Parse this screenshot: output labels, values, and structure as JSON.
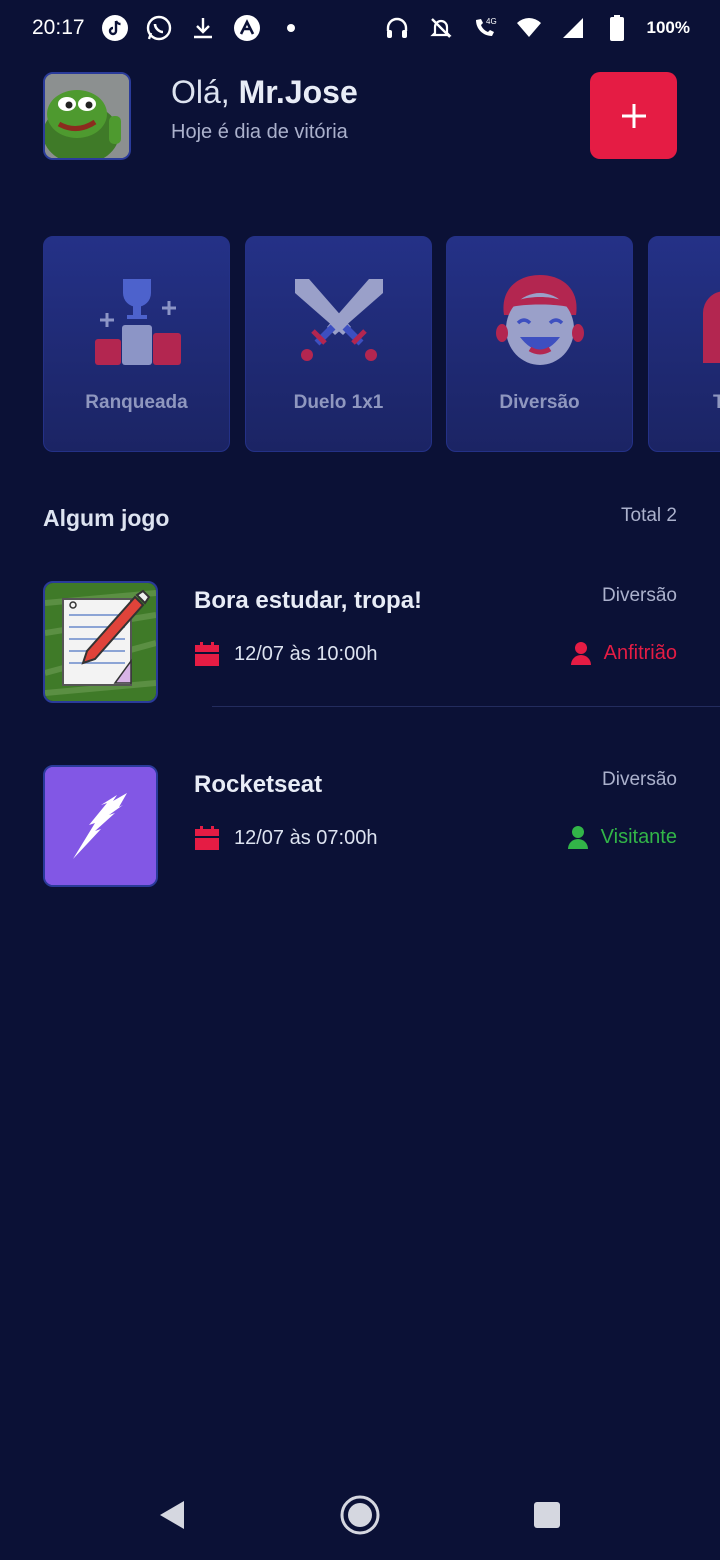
{
  "status_bar": {
    "time": "20:17",
    "battery": "100%",
    "icons": [
      "tiktok-icon",
      "whatsapp-icon",
      "download-icon",
      "app-icon",
      "dot-icon",
      "headset-icon",
      "bell-off-icon",
      "volte-icon",
      "wifi-icon",
      "signal-icon",
      "battery-icon"
    ]
  },
  "header": {
    "greeting_prefix": "Olá,",
    "user_name": "Mr.Jose",
    "subtitle": "Hoje é dia de vitória",
    "add_button_icon": "plus-icon"
  },
  "categories": [
    {
      "label": "Ranqueada",
      "icon": "podium-trophy-icon"
    },
    {
      "label": "Duelo 1x1",
      "icon": "crossed-swords-icon"
    },
    {
      "label": "Diversão",
      "icon": "laughing-face-icon"
    },
    {
      "label": "T",
      "icon": "partial-card-icon"
    }
  ],
  "section": {
    "title": "Algum jogo",
    "total": "Total 2"
  },
  "games": [
    {
      "title": "Bora estudar, tropa!",
      "category": "Diversão",
      "date": "12/07 às 10:00h",
      "role": "Anfitrião",
      "role_color": "#e51c44"
    },
    {
      "title": "Rocketseat",
      "category": "Diversão",
      "date": "12/07 às 07:00h",
      "role": "Visitante",
      "role_color": "#32b548"
    }
  ],
  "colors": {
    "background": "#0b1136",
    "accent": "#e51c44",
    "card": "#243187",
    "guest": "#32b548"
  },
  "nav": [
    "back-icon",
    "home-icon",
    "recents-icon"
  ]
}
